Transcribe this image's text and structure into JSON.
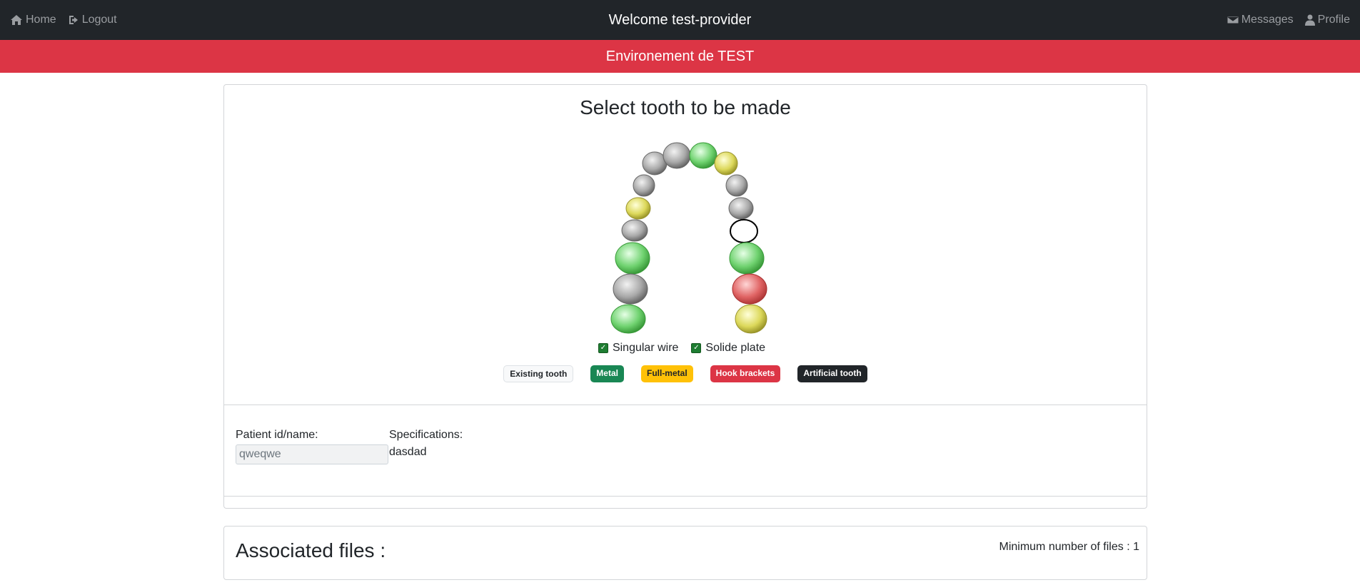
{
  "header": {
    "home_label": "Home",
    "logout_label": "Logout",
    "welcome_text": "Welcome test-provider",
    "messages_label": "Messages",
    "profile_label": "Profile"
  },
  "banner": {
    "text": "Environement de TEST"
  },
  "tooth_section": {
    "title": "Select tooth to be made",
    "options": [
      {
        "label": "Singular wire",
        "checked": true
      },
      {
        "label": "Solide plate",
        "checked": true
      }
    ],
    "legend": [
      {
        "label": "Existing tooth",
        "color": "#f8f9fa"
      },
      {
        "label": "Metal",
        "color": "#198754"
      },
      {
        "label": "Full-metal",
        "color": "#ffc107"
      },
      {
        "label": "Hook brackets",
        "color": "#dc3545"
      },
      {
        "label": "Artificial tooth",
        "color": "#212529"
      }
    ],
    "teeth_state_colors": {
      "gray": "#9a9a9a",
      "green": "#5cc95c",
      "yellow": "#d6d44a",
      "red": "#d9534f",
      "empty": "#ffffff"
    }
  },
  "patient": {
    "label": "Patient id/name:",
    "value": "qweqwe"
  },
  "specifications": {
    "label": "Specifications:",
    "value": "dasdad"
  },
  "files": {
    "title": "Associated files :",
    "min_files_text": "Minimum number of files : 1"
  }
}
